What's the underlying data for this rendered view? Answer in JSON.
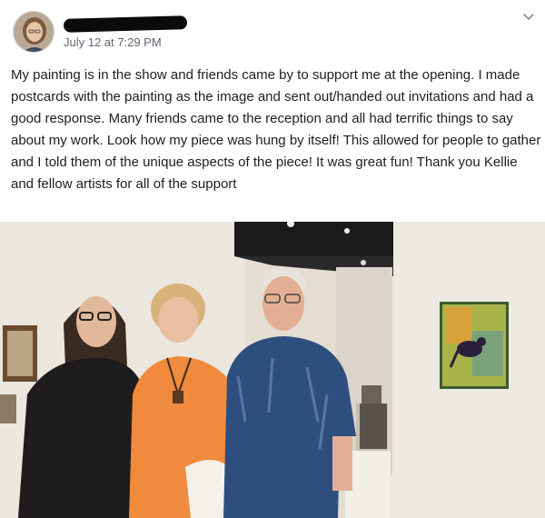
{
  "post": {
    "author_name": "",
    "timestamp": "July 12 at 7:29 PM",
    "text": "My painting is in the show and friends came by to support me at the opening. I made postcards with the painting as the image and sent out/handed out invitations and had a good response. Many friends came to the reception and all had terrific things to say about my work. Look how my piece was hung by itself! This allowed for people to gather and I told them of the unique aspects of the piece! It was great fun! Thank you Kellie and fellow artists for all of the support"
  },
  "icons": {
    "options": "chevron-down-icon",
    "avatar": "profile-photo"
  },
  "colors": {
    "text": "#1c1e21",
    "meta": "#606770",
    "wall": "#e9e4dc",
    "ceiling": "#1a1a1a"
  }
}
